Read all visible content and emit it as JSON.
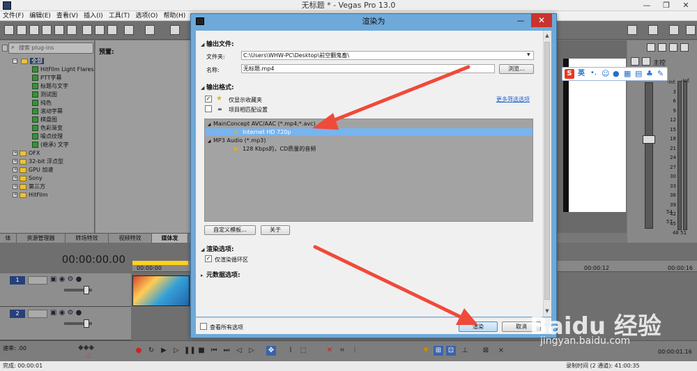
{
  "window": {
    "title": "无标题 * - Vegas Pro 13.0",
    "controls": {
      "minimize": "—",
      "maximize": "❐",
      "close": "✕"
    }
  },
  "menu": [
    "文件(F)",
    "编辑(E)",
    "查看(V)",
    "插入(I)",
    "工具(T)",
    "选项(O)",
    "帮助(H)"
  ],
  "explorer": {
    "search_placeholder": "搜索 plug-ins",
    "preview_label": "预置:",
    "tree": [
      {
        "label": "全部",
        "kind": "folder",
        "expanded": true,
        "selected": true
      },
      {
        "label": "HitFilm Light Flares",
        "kind": "plugin"
      },
      {
        "label": "PTT字幕",
        "kind": "plugin"
      },
      {
        "label": "标题与文字",
        "kind": "plugin"
      },
      {
        "label": "测试图",
        "kind": "plugin"
      },
      {
        "label": "纯色",
        "kind": "plugin"
      },
      {
        "label": "滚动字幕",
        "kind": "plugin"
      },
      {
        "label": "棋盘图",
        "kind": "plugin"
      },
      {
        "label": "色彩渐变",
        "kind": "plugin"
      },
      {
        "label": "噪点纹理",
        "kind": "plugin"
      },
      {
        "label": "(继承) 文字",
        "kind": "plugin"
      },
      {
        "label": "OFX",
        "kind": "folder"
      },
      {
        "label": "32-bit 浮点型",
        "kind": "folder"
      },
      {
        "label": "GPU 加速",
        "kind": "folder"
      },
      {
        "label": "Sony",
        "kind": "folder"
      },
      {
        "label": "第三方",
        "kind": "folder"
      },
      {
        "label": "HitFilm",
        "kind": "folder"
      }
    ],
    "tabs": [
      "体",
      "资源管理器",
      "转场特效",
      "视频特效",
      "媒体发"
    ]
  },
  "mixer": {
    "label": "主控",
    "scale": [
      "-Inf.",
      "-Inf.",
      "3",
      "6",
      "9",
      "12",
      "15",
      "18",
      "21",
      "24",
      "27",
      "30",
      "33",
      "36",
      "39",
      "42",
      "45",
      "48",
      "51",
      "54",
      "57"
    ]
  },
  "ime": {
    "brand": "S",
    "mode": "英"
  },
  "timeline": {
    "timecode": "00:00:00.00",
    "tracks": [
      "1",
      "2"
    ],
    "ruler": [
      "00:00:00",
      "00:00:12",
      "00:00:16"
    ],
    "rate_label": "速率: .00",
    "end_time": "00:00:01.16",
    "status_left": "完成: 00:00:01",
    "status_right": "录制时间 (2 通道): 41:00:35"
  },
  "dialog": {
    "title": "渲染为",
    "output_file": {
      "section": "输出文件:",
      "folder_label": "文件夹:",
      "folder_value": "C:\\Users\\WHW-PC\\Desktop\\前空翻鬼畜\\",
      "name_label": "名称:",
      "name_value": "无标题.mp4",
      "browse": "浏览..."
    },
    "output_format": {
      "section": "输出格式:",
      "favorites_only": "仅显示收藏夹",
      "match_project": "项目相匹配设置",
      "more_filters": "更多筛选选项",
      "formats": [
        {
          "name": "MainConcept AVC/AAC (*.mp4;*.avc)",
          "presets": [
            "Internet HD 720p"
          ]
        },
        {
          "name": "MP3 Audio (*.mp3)",
          "presets": [
            "128 Kbps的，CD质量的音频"
          ]
        }
      ],
      "custom_template": "自定义模板...",
      "about": "关于"
    },
    "render_options": {
      "section": "渲染选项:",
      "loop_only": "仅渲染循环区"
    },
    "metadata_section": "元数据选项:",
    "show_all": "查看所有选项",
    "render_button": "渲染",
    "cancel_button": "取消"
  },
  "watermark": {
    "brand": "Baidu 经验",
    "url": "jingyan.baidu.com"
  },
  "colors": {
    "dialog_frame": "#6ea9d9",
    "selection": "#77b4f0",
    "close": "#c8332d",
    "arrow": "#f04a3a"
  }
}
